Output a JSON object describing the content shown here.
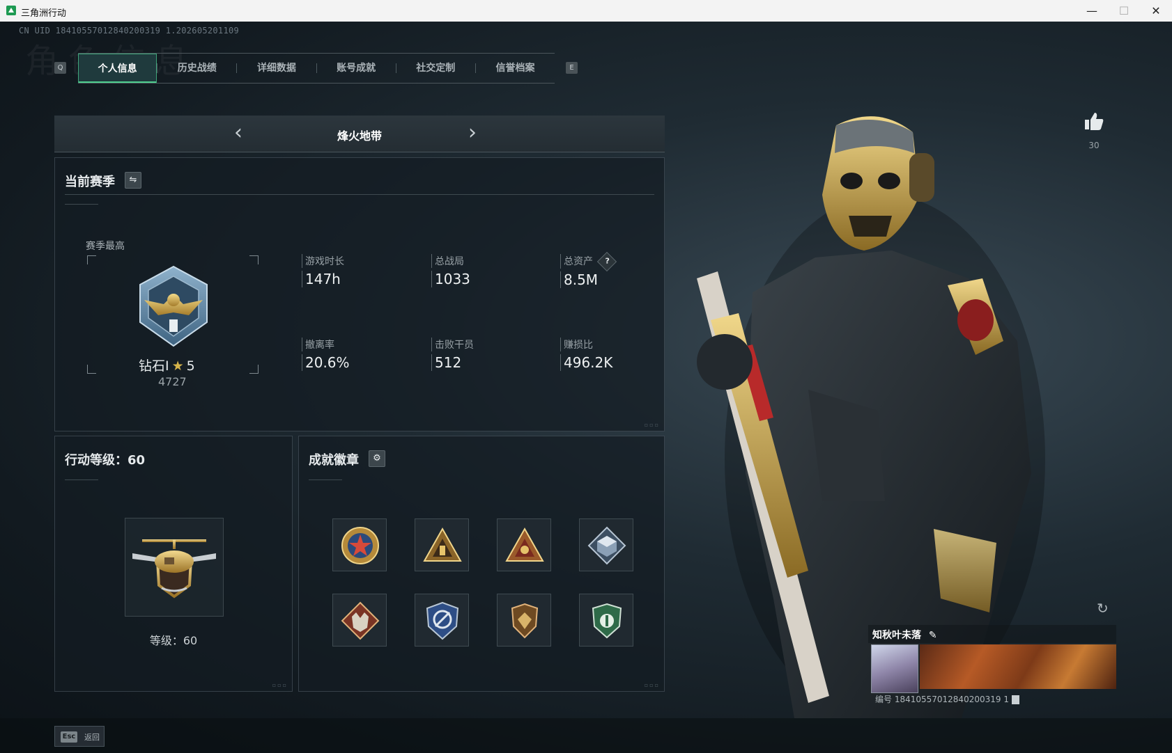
{
  "window": {
    "title": "三角洲行动",
    "minimize": "—",
    "maximize": "☐",
    "close": "✕"
  },
  "uid_line": "CN UID 18410557012840200319 1.202605201109",
  "background_title": "角色信息",
  "tabs": {
    "left_key": "Q",
    "right_key": "E",
    "items": [
      {
        "label": "个人信息",
        "active": true
      },
      {
        "label": "历史战绩",
        "active": false
      },
      {
        "label": "详细数据",
        "active": false
      },
      {
        "label": "账号成就",
        "active": false
      },
      {
        "label": "社交定制",
        "active": false
      },
      {
        "label": "信誉档案",
        "active": false
      }
    ]
  },
  "mode": {
    "title": "烽火地带",
    "prev": "‹",
    "next": "›"
  },
  "season": {
    "heading": "当前赛季",
    "swap_icon": "⇋",
    "best_label": "赛季最高",
    "rank_name": "钻石Ⅰ",
    "rank_stars": "5",
    "rank_score": "4727",
    "stats": [
      {
        "label": "游戏时长",
        "value": "147h"
      },
      {
        "label": "总战局",
        "value": "1033"
      },
      {
        "label": "总资产",
        "value": "8.5M",
        "help": "?"
      },
      {
        "label": "撤离率",
        "value": "20.6%"
      },
      {
        "label": "击败干员",
        "value": "512"
      },
      {
        "label": "赚损比",
        "value": "496.2K"
      }
    ]
  },
  "level": {
    "heading": "行动等级：60",
    "text": "等级：60"
  },
  "badges": {
    "heading": "成就徽章",
    "settings_icon": "⚙",
    "count": 8
  },
  "likes": {
    "count": "30",
    "icon": "thumbs-up-icon"
  },
  "profile": {
    "nickname": "知秋叶未落",
    "edit_icon": "✎",
    "id_line": "编号 18410557012840200319 1"
  },
  "footer": {
    "esc_key": "Esc",
    "esc_label": "返回"
  },
  "colors": {
    "accent": "#4fd08f",
    "gold": "#d6b44a",
    "panel_bg": "#141c22"
  }
}
